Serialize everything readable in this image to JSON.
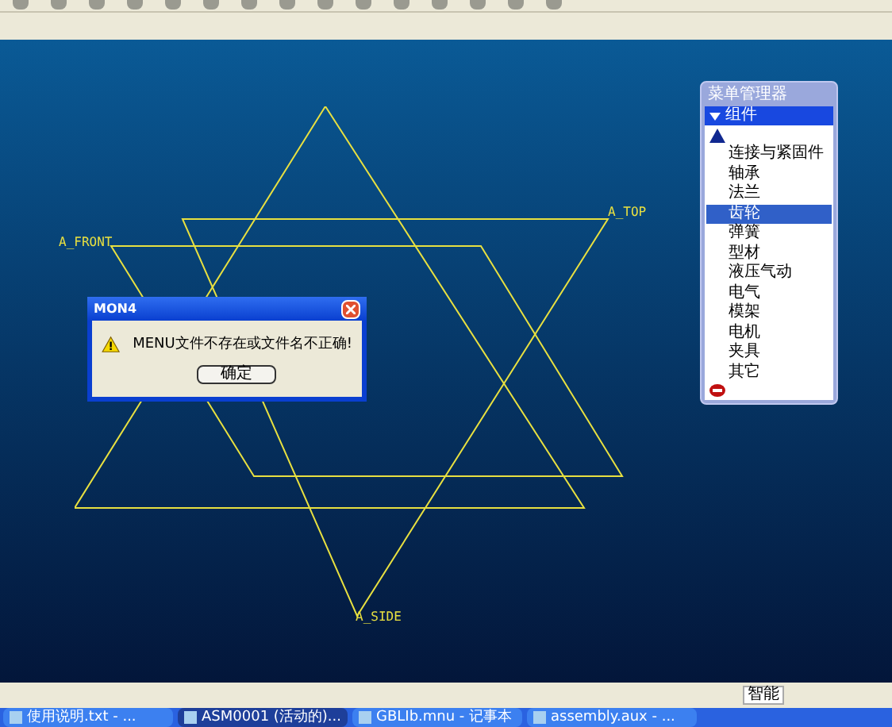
{
  "canvas": {
    "datum_labels": [
      {
        "text": "A_FRONT",
        "kind": "front"
      },
      {
        "text": "A_TOP",
        "kind": "top"
      },
      {
        "text": "A_SIDE",
        "kind": "side"
      }
    ]
  },
  "dialog": {
    "title": "MON4",
    "message": "MENU文件不存在或文件名不正确!",
    "button": "确定"
  },
  "menu_manager": {
    "title": "菜单管理器",
    "section": {
      "label": "组件",
      "expanded": true
    },
    "items": [
      {
        "label": "连接与紧固件",
        "selected": false
      },
      {
        "label": "轴承",
        "selected": false
      },
      {
        "label": "法兰",
        "selected": false
      },
      {
        "label": "齿轮",
        "selected": true
      },
      {
        "label": "弹簧",
        "selected": false
      },
      {
        "label": "型材",
        "selected": false
      },
      {
        "label": "液压气动",
        "selected": false
      },
      {
        "label": "电气",
        "selected": false
      },
      {
        "label": "模架",
        "selected": false
      },
      {
        "label": "电机",
        "selected": false
      },
      {
        "label": "夹具",
        "selected": false
      },
      {
        "label": "其它",
        "selected": false
      }
    ]
  },
  "status_bar": {
    "mode": "智能"
  },
  "taskbar": [
    {
      "label": "使用说明.txt - ...",
      "selected": false
    },
    {
      "label": "ASM0001 (活动的)...",
      "selected": true
    },
    {
      "label": "GBLIb.mnu - 记事本",
      "selected": false
    },
    {
      "label": "assembly.aux - ...",
      "selected": false
    }
  ]
}
